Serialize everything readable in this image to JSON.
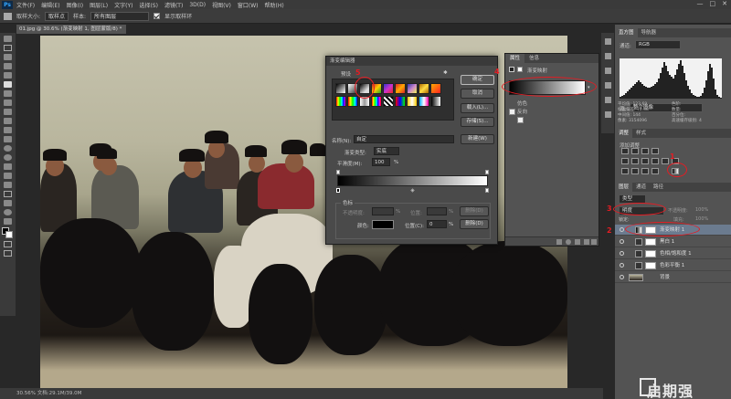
{
  "menubar": {
    "logo": "Ps",
    "items": [
      "文件(F)",
      "编辑(E)",
      "图像(I)",
      "图层(L)",
      "文字(Y)",
      "选择(S)",
      "滤镜(T)",
      "3D(D)",
      "视图(V)",
      "窗口(W)",
      "帮助(H)"
    ],
    "window_controls": [
      "—",
      "□",
      "✕"
    ]
  },
  "options": {
    "sample_size_label": "取样大小:",
    "sample_size_value": "取样点",
    "sample_label": "样本:",
    "sample_value": "所有图层",
    "show_ring_label": "显示取样环"
  },
  "document": {
    "tab_title": "01.jpg @ 30.6% (渐变映射 1, 图层蒙版/8) *",
    "status": "30.56%   文档:29.1M/39.0M"
  },
  "gradient_dialog": {
    "title": "渐变编辑器",
    "presets_label": "预设",
    "ok_label": "确定",
    "cancel_label": "取消",
    "load_label": "载入(L)...",
    "save_label": "存储(S)...",
    "name_label": "名称(N):",
    "name_value": "自定",
    "new_label": "新建(W)",
    "gradient_type_label": "渐变类型:",
    "gradient_type_value": "实底",
    "smoothness_label": "平滑度(M):",
    "smoothness_value": "100",
    "smoothness_unit": "%",
    "color_stops_label": "色标",
    "opacity_label": "不透明度:",
    "opacity_unit": "%",
    "location_label": "位置:",
    "location_unit": "%",
    "delete_label": "删除(D)",
    "color_label": "颜色:",
    "location2_label": "位置(C):",
    "location2_value": "0",
    "delete2_label": "删除(D)"
  },
  "properties_panel": {
    "tabs": [
      "属性",
      "信息"
    ],
    "title": "渐变映射",
    "dither_label": "仿色",
    "reverse_label": "反向"
  },
  "right_panel": {
    "top_tabs": [
      "直方图",
      "导航器"
    ],
    "channel_label": "通道:",
    "channel_value": "RGB",
    "source_label": "源:",
    "source_value": "整个图像",
    "stats_left": [
      "平均值: 123.69",
      "标准偏差: 70.48",
      "中间值: 144",
      "像素: 3154096"
    ],
    "stats_right": [
      "色阶:",
      "数量:",
      "百分位:",
      "高速缓存级别: 4"
    ],
    "adj_tabs": [
      "调整",
      "样式"
    ],
    "adj_title": "添加调整",
    "layer_tabs": [
      "图层",
      "通道",
      "路径"
    ],
    "kind_label": "类型",
    "blend_value": "明度",
    "opacity_label": "不透明度:",
    "opacity_value": "100%",
    "lock_label": "锁定:",
    "fill_label": "填充:",
    "fill_value": "100%",
    "layers": [
      {
        "name": "渐变映射 1",
        "selected": true
      },
      {
        "name": "黑白 1",
        "selected": false
      },
      {
        "name": "色相/饱和度 1",
        "selected": false
      },
      {
        "name": "色彩平衡 1",
        "selected": false
      },
      {
        "name": "背景",
        "selected": false
      }
    ]
  },
  "annotations": {
    "num1": "1",
    "num2": "2",
    "num3": "3",
    "num4": "4",
    "num5": "5"
  },
  "watermark": "启期强",
  "colors": {
    "accent_red": "#e51c23",
    "selected_layer": "#6b7b8f"
  }
}
